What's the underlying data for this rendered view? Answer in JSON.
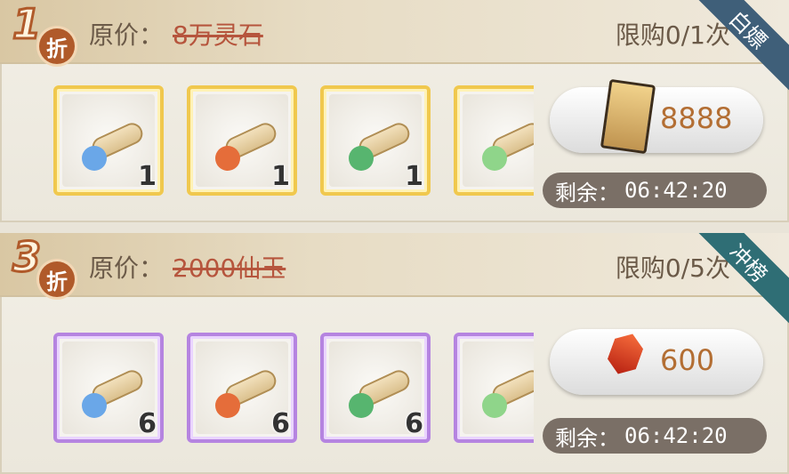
{
  "offers": [
    {
      "discount_digit": "1",
      "discount_char": "折",
      "price_label": "原价：",
      "original_price": "8万灵石",
      "limit_text": "限购0/1次",
      "ribbon": "白嫖",
      "items": [
        {
          "icon": "scroll-blue-flower-icon",
          "count": "1",
          "frame": "gold"
        },
        {
          "icon": "scroll-red-orb-icon",
          "count": "1",
          "frame": "gold"
        },
        {
          "icon": "scroll-green-drop-icon",
          "count": "1",
          "frame": "gold"
        },
        {
          "icon": "scroll-green-cloud-icon",
          "count": "",
          "frame": "gold"
        }
      ],
      "buy_price": "8888",
      "buy_currency_icon": "golden-scroll-icon",
      "timer_label": "剩余：",
      "timer_value": "06:42:20"
    },
    {
      "discount_digit": "3",
      "discount_char": "折",
      "price_label": "原价：",
      "original_price": "2000仙玉",
      "limit_text": "限购0/5次",
      "ribbon": "冲榜",
      "items": [
        {
          "icon": "scroll-blue-flower-icon",
          "count": "6",
          "frame": "purple"
        },
        {
          "icon": "scroll-red-orb-icon",
          "count": "6",
          "frame": "purple"
        },
        {
          "icon": "scroll-green-drop-icon",
          "count": "6",
          "frame": "purple"
        },
        {
          "icon": "scroll-green-cloud-icon",
          "count": "",
          "frame": "purple"
        }
      ],
      "buy_price": "600",
      "buy_currency_icon": "red-jade-gem-icon",
      "timer_label": "剩余：",
      "timer_value": "06:42:20"
    }
  ],
  "colors": {
    "gold_frame": "#f0c84e",
    "purple_frame": "#b584e0",
    "strike_price": "#b6553d",
    "ribbon_blue": "#3f5f79",
    "ribbon_teal": "#2f6e75",
    "timer_bg": "#7a6f66"
  }
}
